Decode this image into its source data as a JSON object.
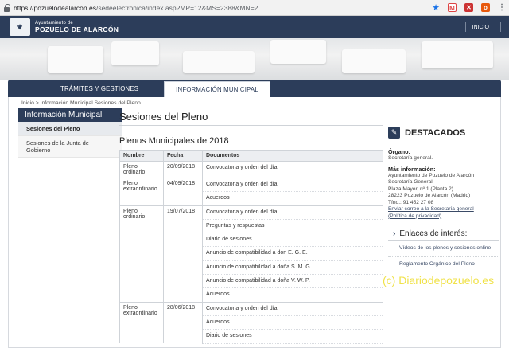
{
  "browser": {
    "url_host": "https://pozuelodealarcon.es",
    "url_path": "/sedeelectronica/index.asp?MP=12&MS=2388&MN=2",
    "icons": [
      "lock-icon",
      "star-icon",
      "gmail-icon",
      "extension-icon",
      "office-icon",
      "menu-icon"
    ]
  },
  "header": {
    "logo_line1": "Ayuntamiento de",
    "logo_line2": "POZUELO DE ALARCÓN",
    "inicio": "INICIO"
  },
  "nav": {
    "tabs": [
      {
        "label": "TRÁMITES Y GESTIONES"
      },
      {
        "label": "INFORMACIÓN MUNICIPAL"
      }
    ]
  },
  "breadcrumb": "Inicio > Información Municipal Sesiones del Pleno",
  "sidebar": {
    "title": "Información Municipal",
    "items": [
      {
        "label": "Sesiones del Pleno"
      },
      {
        "label": "Sesiones de la Junta de Gobierno"
      }
    ]
  },
  "main": {
    "title": "Sesiones del Pleno",
    "section_title": "Plenos Municipales de 2018",
    "columns": [
      "Nombre",
      "Fecha",
      "Documentos"
    ],
    "sessions": [
      {
        "name": "Pleno ordinario",
        "date": "20/09/2018",
        "docs": [
          "Convocatoria y orden del día"
        ]
      },
      {
        "name": "Pleno extraordinario",
        "date": "04/09/2018",
        "docs": [
          "Convocatoria y orden del día",
          "Acuerdos"
        ]
      },
      {
        "name": "Pleno ordinario",
        "date": "19/07/2018",
        "docs": [
          "Convocatoria y orden del día",
          "Preguntas y respuestas",
          "Diario de sesiones",
          "Anuncio de compatibilidad a don E. G. E.",
          "Anuncio de compatibilidad a doña S. M. G.",
          "Anuncio de compatibilidad a doña V. W. P.",
          "Acuerdos"
        ]
      },
      {
        "name": "Pleno extraordinario",
        "date": "28/06/2018",
        "docs": [
          "Convocatoria y orden del día",
          "Acuerdos",
          "Diario de sesiones"
        ]
      }
    ]
  },
  "aside": {
    "title": "DESTACADOS",
    "organo_label": "Órgano:",
    "organo_value": "Secretaría general.",
    "info_label": "Más información:",
    "address": [
      "Ayuntamiento de Pozuelo de Alarcón",
      "Secretaría General",
      "Plaza Mayor, nº 1 (Planta 2)",
      "28223 Pozuelo de Alarcón (Madrid)",
      "Tfno.: 91 452 27 08"
    ],
    "email_link": "Enviar correo a la Secretaría general",
    "privacy_link": "(Política de privacidad)",
    "links_title": "Enlaces de interés:",
    "links": [
      "Vídeos de los plenos y sesiones online",
      "Reglamento Orgánico del Pleno"
    ]
  },
  "watermark": "(c) Diariodepozuelo.es"
}
